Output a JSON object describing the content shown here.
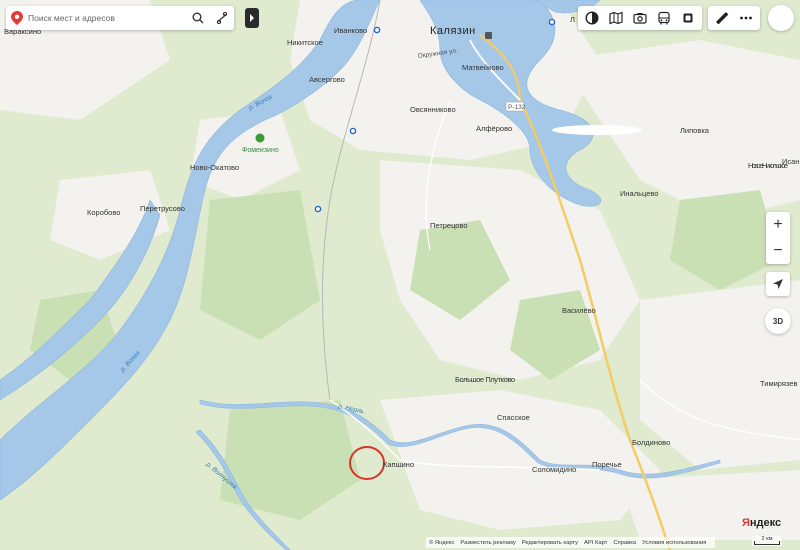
{
  "search": {
    "placeholder": "Поиск мест и адресов"
  },
  "zoom": {
    "plus": "+",
    "minus": "−"
  },
  "view3d": {
    "label": "3D"
  },
  "logo": "Яндекс",
  "footer": {
    "copyright": "© Яндекс",
    "links": [
      "Разместить рекламу",
      "Редактировать карту",
      "API Карт",
      "Справка",
      "Условия использования"
    ]
  },
  "scale": "2 км",
  "map": {
    "city_main": "Калязин",
    "places": {
      "varaksino": "Вараксино",
      "nikitskoe": "Никитское",
      "ivankovo": "Иванково",
      "avsergovo": "Авсергово",
      "matveykovo": "Матвейково",
      "ovsyannikovo": "Овсянниково",
      "alferovo": "Алфёрово",
      "lipovka": "Липовка",
      "novoe_nikolskoe": "Новое Никольское",
      "isanovo": "Исан",
      "inyaltsevo": "Инальцево",
      "novo_okatovo": "Ново-Окатово",
      "korobovo": "Коробово",
      "peretrusovo": "Перетрусово",
      "petretsovo": "Петрецово",
      "vasilevo": "Василёво",
      "timiryazevo": "Тимирязев",
      "bolshoe_plutkovo": "Большое Плутково",
      "spasskoe": "Спасское",
      "boldinovo": "Болдиново",
      "solomidino": "Соломидино",
      "porechie": "Поречье",
      "kapshino": "Капшино",
      "okruzhnaya": "Окружная ул.",
      "l_top": "Л"
    },
    "poi": {
      "fomeinzino": "Фомеизино"
    },
    "rivers": {
      "volga1": "р. Волга",
      "volga2": "р. Волга",
      "nerl": "р. Нерль",
      "volnushka": "р. Волнушка"
    },
    "road": "Р-132"
  },
  "colors": {
    "water": "#a6c8e8",
    "water_stroke": "#8fb6de",
    "forest": "#d5e6c4",
    "open": "#f4f3ef",
    "road_main": "#f3cc63",
    "circle": "#d8342c"
  }
}
